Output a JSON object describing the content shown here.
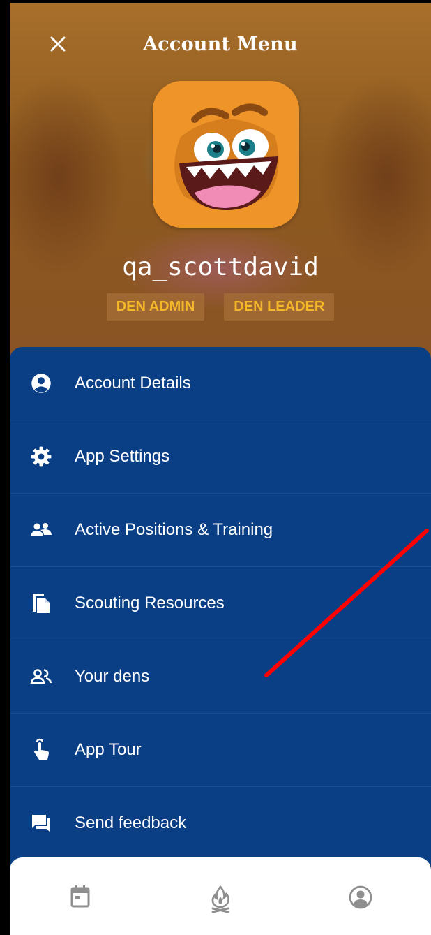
{
  "header": {
    "title": "Account Menu",
    "close_icon": "close-icon",
    "username": "qa_scottdavid",
    "badges": [
      "DEN ADMIN",
      "DEN LEADER"
    ]
  },
  "menu": {
    "items": [
      {
        "label": "Account Details",
        "icon": "account-circle-icon"
      },
      {
        "label": "App Settings",
        "icon": "gear-icon"
      },
      {
        "label": "Active Positions & Training",
        "icon": "group-icon"
      },
      {
        "label": "Scouting Resources",
        "icon": "documents-icon"
      },
      {
        "label": "Your dens",
        "icon": "people-outline-icon"
      },
      {
        "label": "App Tour",
        "icon": "touch-hand-icon"
      },
      {
        "label": "Send feedback",
        "icon": "feedback-chat-icon"
      }
    ]
  },
  "bottom_nav": {
    "items": [
      {
        "icon": "calendar-icon"
      },
      {
        "icon": "campfire-icon"
      },
      {
        "icon": "account-icon"
      }
    ]
  },
  "colors": {
    "menu_bg": "#0a3f86",
    "badge_text": "#f5b828",
    "annotation": "#ff0000"
  }
}
